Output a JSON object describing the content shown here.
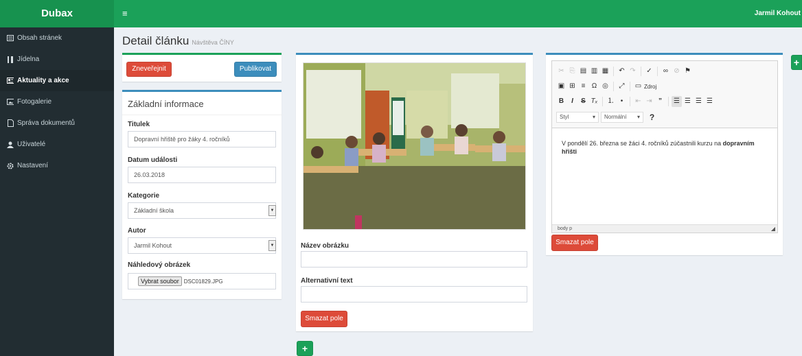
{
  "app": {
    "brand": "Dubax",
    "menu_icon": "≡",
    "user": "Jarmil Kohout"
  },
  "sidebar": {
    "items": [
      {
        "label": "Obsah stránek",
        "icon": "list-icon"
      },
      {
        "label": "Jídelna",
        "icon": "cutlery-icon"
      },
      {
        "label": "Aktuality a akce",
        "icon": "newspaper-icon",
        "active": true
      },
      {
        "label": "Fotogalerie",
        "icon": "image-icon"
      },
      {
        "label": "Správa dokumentů",
        "icon": "file-icon"
      },
      {
        "label": "Uživatelé",
        "icon": "user-icon"
      },
      {
        "label": "Nastavení",
        "icon": "gear-icon"
      }
    ]
  },
  "page": {
    "title": "Detail článku",
    "subtitle": "Návštěva ČÍNY"
  },
  "actions": {
    "unpublish": "Zneveřejnit",
    "publish": "Publikovat"
  },
  "info": {
    "title": "Základní informace",
    "title_label": "Titulek",
    "title_value": "Dopravní hřiště pro žáky 4. ročníků",
    "date_label": "Datum události",
    "date_value": "26.03.2018",
    "category_label": "Kategorie",
    "category_value": "Základní škola",
    "author_label": "Autor",
    "author_value": "Jarmil Kohout",
    "thumb_label": "Náhledový obrázek",
    "file_button": "Vybrat soubor",
    "file_name": "DSC01829.JPG"
  },
  "image_block": {
    "name_label": "Název obrázku",
    "alt_label": "Alternativní text",
    "delete_label": "Smazat pole",
    "add_label": "+"
  },
  "editor": {
    "styles_combo": "Styl",
    "format_combo": "Normální",
    "source_label": "Zdroj",
    "help": "?",
    "text_before": "V pondělí 26. března se žáci 4. ročníků zúčastnili kurzu na ",
    "text_bold": "dopravním hřišti",
    "status": "body   p",
    "delete_label": "Smazat pole",
    "add_label": "+"
  },
  "colors": {
    "header": "#1ba159",
    "sidebar": "#222d32",
    "danger": "#dd4b39",
    "primary": "#3c8dbc"
  }
}
